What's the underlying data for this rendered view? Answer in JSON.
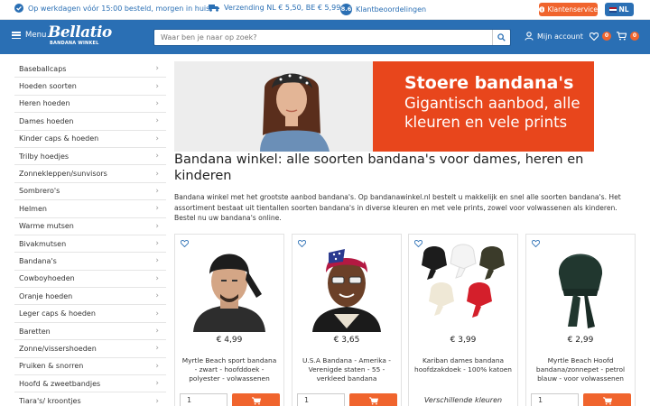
{
  "topbar": {
    "usp_delivery": "Op werkdagen vóór 15:00 besteld, morgen in huis*",
    "usp_shipping": "Verzending NL € 5,50, BE € 5,99",
    "rating_score": "8.6",
    "usp_reviews": "Klantbeoordelingen",
    "customer_service": "Klantenservice",
    "language": "NL"
  },
  "header": {
    "menu_label": "Menu",
    "logo_text": "Bellatio",
    "logo_subtext": "BANDANA WINKEL",
    "search_placeholder": "Waar ben je naar op zoek?",
    "account_label": "Mijn account",
    "wishlist_count": "0",
    "cart_count": "0"
  },
  "sidebar": {
    "items": [
      "Baseballcaps",
      "Hoeden soorten",
      "Heren hoeden",
      "Dames hoeden",
      "Kinder caps & hoeden",
      "Trilby hoedjes",
      "Zonnekleppen/sunvisors",
      "Sombrero's",
      "Helmen",
      "Warme mutsen",
      "Bivakmutsen",
      "Bandana's",
      "Cowboyhoeden",
      "Oranje hoeden",
      "Leger caps & hoeden",
      "Baretten",
      "Zonne/vissershoeden",
      "Pruiken & snorren",
      "Hoofd & zweetbandjes",
      "Tiara's/ kroontjes"
    ]
  },
  "banner": {
    "line1": "Stoere bandana's",
    "line2": "Gigantisch aanbod, alle",
    "line3": "kleuren en vele prints"
  },
  "main": {
    "title": "Bandana winkel: alle soorten bandana's voor dames, heren en kinderen",
    "intro": "Bandana winkel met het grootste aanbod bandana's. Op bandanawinkel.nl bestelt u makkelijk en snel alle soorten bandana's. Het assortiment bestaat uit tientallen soorten bandana's in diverse kleuren en met vele prints, zowel voor volwassenen als kinderen. Bestel nu uw bandana's online."
  },
  "products": [
    {
      "price": "€ 4,99",
      "name": "Myrtle Beach sport bandana - zwart - hoofddoek - polyester - volwassenen",
      "qty": "1",
      "image": "black-bandana-man"
    },
    {
      "price": "€ 3,65",
      "name": "U.S.A Bandana - Amerika - Verenigde staten - 55 - verkleed bandana",
      "qty": "1",
      "image": "usa-flag-bandana"
    },
    {
      "price": "€ 3,99",
      "name": "Kariban dames bandana hoofdzakdoek - 100% katoen",
      "variants_label": "Verschillende kleuren",
      "image": "colored-bandanas"
    },
    {
      "price": "€ 2,99",
      "name": "Myrtle Beach Hoofd bandana/zonnepet - petrol blauw - voor volwassenen",
      "qty": "1",
      "image": "petrol-bandana"
    }
  ],
  "colors": {
    "brand_blue": "#2a6fb4",
    "accent_orange": "#f0642d",
    "banner_red": "#e8461c"
  }
}
